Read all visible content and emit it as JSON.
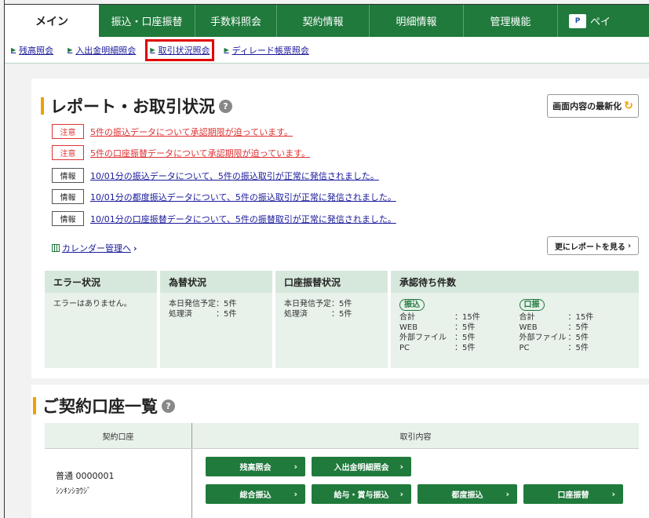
{
  "nav": {
    "tabs": [
      {
        "label": "メイン",
        "active": true
      },
      {
        "label": "振込・口座振替"
      },
      {
        "label": "手数料照会"
      },
      {
        "label": "契約情報"
      },
      {
        "label": "明細情報"
      },
      {
        "label": "管理機能"
      }
    ],
    "pay_label": "ペイ",
    "pay_logo_text": "P"
  },
  "subnav": [
    {
      "label": "残高照会"
    },
    {
      "label": "入出金明細照会"
    },
    {
      "label": "取引状況照会",
      "highlighted": true
    },
    {
      "label": "ディレード帳票照会"
    }
  ],
  "report": {
    "title": "レポート・お取引状況",
    "help": "?",
    "refresh_label": "画面内容の最新化",
    "notices": [
      {
        "badge": "注意",
        "type": "warn",
        "text": "5件の振込データについて承認期限が迫っています。"
      },
      {
        "badge": "注意",
        "type": "warn",
        "text": "5件の口座振替データについて承認期限が迫っています。"
      },
      {
        "badge": "情報",
        "type": "info",
        "text": "10/01分の振込データについて、5件の振込取引が正常に発信されました。"
      },
      {
        "badge": "情報",
        "type": "info",
        "text": "10/01分の都度振込データについて、5件の振込取引が正常に発信されました。"
      },
      {
        "badge": "情報",
        "type": "info",
        "text": "10/01分の口座振替データについて、5件の振替取引が正常に発信されました。"
      }
    ],
    "calendar_link": "カレンダー管理へ",
    "more_label": "更にレポートを見る"
  },
  "status": {
    "error": {
      "head": "エラー状況",
      "text": "エラーはありません。"
    },
    "fx": {
      "head": "為替状況",
      "rows": [
        {
          "k": "本日発信予定",
          "v": "：5件"
        },
        {
          "k": "処理済",
          "v": "：5件"
        }
      ]
    },
    "debit": {
      "head": "口座振替状況",
      "rows": [
        {
          "k": "本日発信予定",
          "v": "：5件"
        },
        {
          "k": "処理済",
          "v": "：5件"
        }
      ]
    },
    "approval": {
      "head": "承認待ち件数",
      "groups": [
        {
          "pill": "振込",
          "rows": [
            {
              "k": "合計",
              "v": "：15件"
            },
            {
              "k": "WEB",
              "v": "：5件"
            },
            {
              "k": "外部ファイル",
              "v": "：5件"
            },
            {
              "k": "PC",
              "v": "：5件"
            }
          ]
        },
        {
          "pill": "口振",
          "rows": [
            {
              "k": "合計",
              "v": "：15件"
            },
            {
              "k": "WEB",
              "v": "：5件"
            },
            {
              "k": "外部ファイル",
              "v": "：5件"
            },
            {
              "k": "PC",
              "v": "：5件"
            }
          ]
        }
      ]
    }
  },
  "accounts": {
    "title": "ご契約口座一覧",
    "help": "?",
    "col1": "契約口座",
    "col2": "取引内容",
    "rows": [
      {
        "account": "普通 0000001",
        "kana": "ｼﾝｷﾝｼﾖｳｼﾞ",
        "buttons": [
          "残高照会",
          "入出金明細照会",
          "総合振込",
          "給与・賞与振込",
          "都度振込",
          "口座振替"
        ]
      }
    ]
  },
  "colors": {
    "brand_green": "#1f7a3c",
    "warn_red": "#d33",
    "accent_orange": "#f0a000"
  }
}
